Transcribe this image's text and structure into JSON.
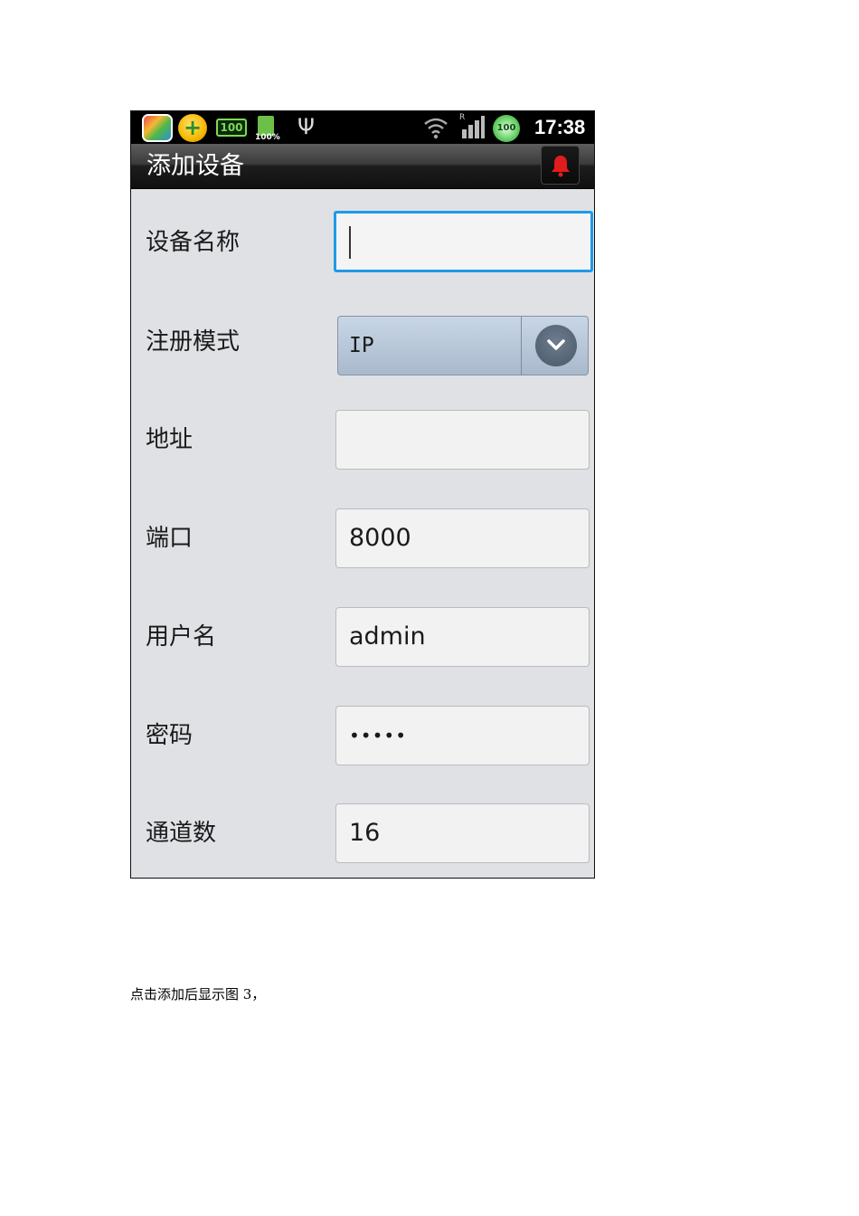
{
  "status_bar": {
    "battery_badge": "100",
    "battery_percent": "100%",
    "cleaner_badge": "100",
    "roaming_indicator": "R",
    "clock": "17:38"
  },
  "header": {
    "title": "添加设备",
    "alarm_icon": "bell-icon",
    "alarm_color": "#e01c1c"
  },
  "form": {
    "device_name": {
      "label": "设备名称",
      "value": ""
    },
    "register_mode": {
      "label": "注册模式",
      "selected": "IP"
    },
    "address": {
      "label": "地址",
      "value": ""
    },
    "port": {
      "label": "端口",
      "value": "8000"
    },
    "username": {
      "label": "用户名",
      "value": "admin"
    },
    "password": {
      "label": "密码",
      "value": "•••••"
    },
    "channels": {
      "label": "通道数",
      "value": "16"
    }
  },
  "focus_color": "#1f9ae8",
  "caption": "点击添加后显示图 3，"
}
